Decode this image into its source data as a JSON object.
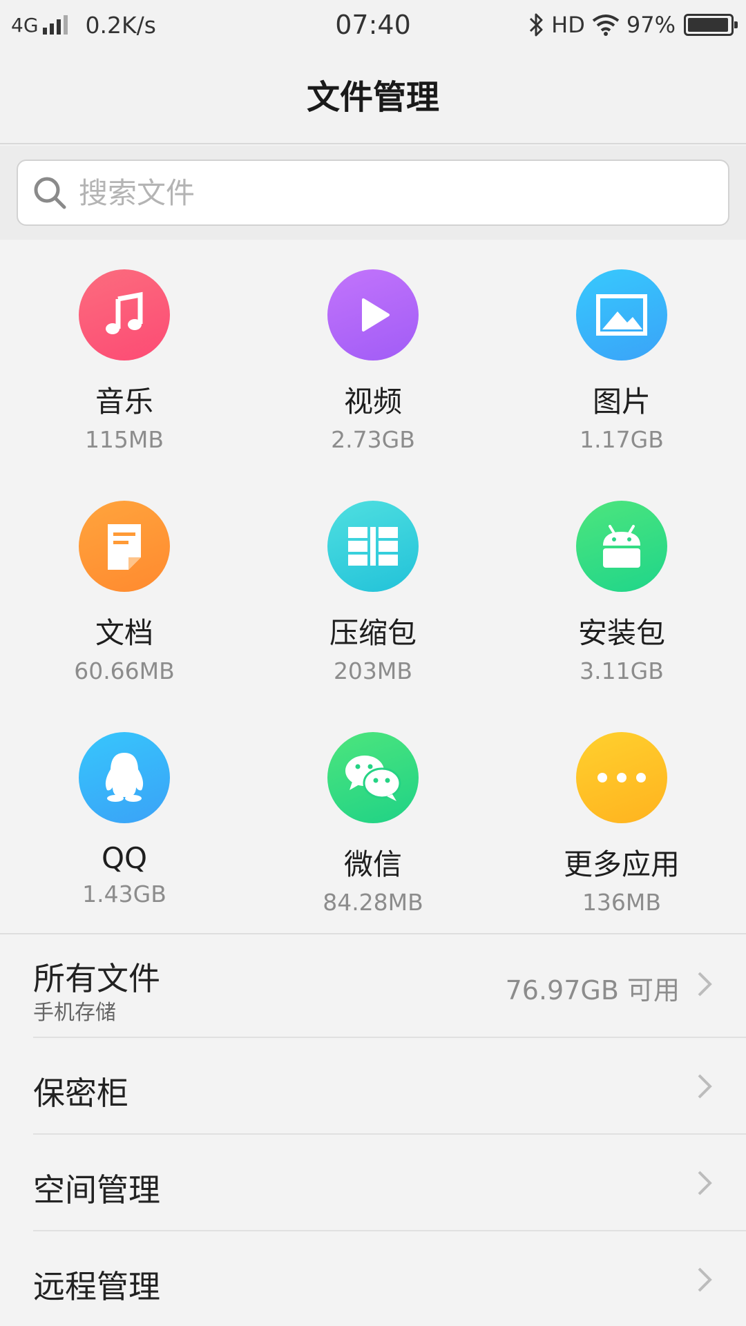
{
  "status_bar": {
    "network": "4G",
    "speed": "0.2K/s",
    "time": "07:40",
    "hd": "HD",
    "battery": "97%",
    "battery_level": 0.97
  },
  "header": {
    "title": "文件管理"
  },
  "search": {
    "placeholder": "搜索文件",
    "icon": "search-icon"
  },
  "categories": [
    {
      "label": "音乐",
      "size": "115MB",
      "icon": "music-note-icon",
      "colors": [
        "#fb6c7e",
        "#fd4b74"
      ]
    },
    {
      "label": "视频",
      "size": "2.73GB",
      "icon": "play-icon",
      "colors": [
        "#c274fb",
        "#a15cf6"
      ]
    },
    {
      "label": "图片",
      "size": "1.17GB",
      "icon": "image-icon",
      "colors": [
        "#37c9fd",
        "#3aa3f8"
      ]
    },
    {
      "label": "文档",
      "size": "60.66MB",
      "icon": "document-icon",
      "colors": [
        "#ffa43d",
        "#ff8a2f"
      ]
    },
    {
      "label": "压缩包",
      "size": "203MB",
      "icon": "archive-icon",
      "colors": [
        "#4fdfe0",
        "#22c2d9"
      ]
    },
    {
      "label": "安装包",
      "size": "3.11GB",
      "icon": "android-icon",
      "colors": [
        "#4de57d",
        "#1fd58a"
      ]
    },
    {
      "label": "QQ",
      "size": "1.43GB",
      "icon": "qq-penguin-icon",
      "colors": [
        "#37c6fc",
        "#3aa2f7"
      ]
    },
    {
      "label": "微信",
      "size": "84.28MB",
      "icon": "wechat-icon",
      "colors": [
        "#4de57d",
        "#1fd286"
      ]
    },
    {
      "label": "更多应用",
      "size": "136MB",
      "icon": "more-dots-icon",
      "colors": [
        "#ffd02e",
        "#ffb31f"
      ]
    }
  ],
  "list": {
    "all_files": {
      "title": "所有文件",
      "subtitle": "手机存储",
      "value": "76.97GB 可用"
    },
    "vault": {
      "title": "保密柜"
    },
    "space": {
      "title": "空间管理"
    },
    "remote": {
      "title": "远程管理"
    }
  }
}
